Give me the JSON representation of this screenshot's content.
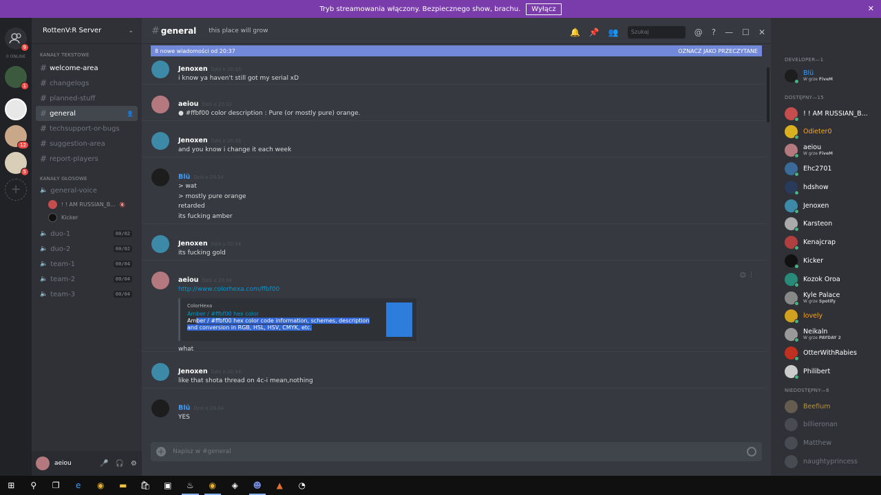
{
  "banner": {
    "text": "Tryb streamowania włączony. Bezpiecznego show, brachu.",
    "button": "Wyłącz"
  },
  "guilds": {
    "online_label": "0 ONLINE",
    "badges": [
      "9",
      "1",
      "",
      "12",
      "5"
    ]
  },
  "server": {
    "name": "RottenV:R Server"
  },
  "text_category": "KANAŁY TEKSTOWE",
  "text_channels": [
    {
      "name": "welcome-area"
    },
    {
      "name": "changelogs"
    },
    {
      "name": "planned-stuff"
    },
    {
      "name": "general"
    },
    {
      "name": "techsupport-or-bugs"
    },
    {
      "name": "suggestion-area"
    },
    {
      "name": "report-players"
    }
  ],
  "voice_category": "KANAŁY GŁOSOWE",
  "voice_channels": [
    {
      "name": "general-voice",
      "count": ""
    },
    {
      "name": "duo-1",
      "count": "00/02"
    },
    {
      "name": "duo-2",
      "count": "00/02"
    },
    {
      "name": "team-1",
      "count": "00/04"
    },
    {
      "name": "team-2",
      "count": "00/04"
    },
    {
      "name": "team-3",
      "count": "00/04"
    }
  ],
  "voice_users": [
    "! ! AM RUSSIAN_B...",
    "Kicker"
  ],
  "current_user": {
    "name": "aeiou"
  },
  "channel": {
    "name": "general",
    "topic": "this place will grow"
  },
  "search": {
    "placeholder": "Szukaj"
  },
  "new_messages": {
    "text": "8 nowe wiadomości od 20:37",
    "mark_read": "OZNACZ JAKO PRZECZYTANE"
  },
  "messages": [
    {
      "author": "Jenoxen",
      "time": "Dziś o 20:33",
      "lines": [
        "i know  ya haven't still got my serial xD"
      ]
    },
    {
      "author": "aeiou",
      "time": "Dziś o 20:33",
      "lines": [
        "● #ffbf00 color description : Pure (or mostly pure) orange."
      ]
    },
    {
      "author": "Jenoxen",
      "time": "Dziś o 20:33",
      "lines": [
        "and you know i change it each week"
      ]
    },
    {
      "author": "Blü",
      "time": "Dziś o 20:34",
      "lines": [
        "> wat",
        "> mostly pure orange",
        "retarded",
        "its fucking amber"
      ]
    },
    {
      "author": "Jenoxen",
      "time": "Dziś o 20:34",
      "lines": [
        "its fucking gold"
      ]
    },
    {
      "author": "aeiou",
      "time": "Dziś o 20:34",
      "link": "http://www.colorhexa.com/ffbf00",
      "after": "what"
    },
    {
      "author": "Jenoxen",
      "time": "Dziś o 20:34",
      "lines": [
        "like that shota thread on 4c-i mean,nothing"
      ]
    },
    {
      "author": "Blü",
      "time": "Dziś o 20:34",
      "lines": [
        "YES"
      ]
    }
  ],
  "embed": {
    "provider": "ColorHexa",
    "title": "Amber / #ffbf00 hex color",
    "desc_a": "Am",
    "desc_b": "ber / #ffbf00 hex color code information, schemes, description and conversion in RGB, HSL, HSV, CMYK, etc."
  },
  "composer": {
    "placeholder": "Napisz w #general"
  },
  "members": {
    "developer_label": "DEVELOPER—1",
    "developer": [
      {
        "name": "Blü",
        "sub_a": "W grze ",
        "sub_b": "FiveM"
      }
    ],
    "online_label": "DOSTĘPNY—15",
    "online": [
      {
        "name": "! ! AM RUSSIAN_B...",
        "sub_a": "",
        "sub_b": ""
      },
      {
        "name": "Odieter0",
        "sub_a": "",
        "sub_b": ""
      },
      {
        "name": "aeiou",
        "sub_a": "W grze ",
        "sub_b": "FiveM"
      },
      {
        "name": "Ehc2701",
        "sub_a": "",
        "sub_b": ""
      },
      {
        "name": "hdshow",
        "sub_a": "",
        "sub_b": ""
      },
      {
        "name": "Jenoxen",
        "sub_a": "",
        "sub_b": ""
      },
      {
        "name": "Karsteon",
        "sub_a": "",
        "sub_b": ""
      },
      {
        "name": "Kenajcrap",
        "sub_a": "",
        "sub_b": ""
      },
      {
        "name": "Kicker",
        "sub_a": "",
        "sub_b": ""
      },
      {
        "name": "Kozok Oroa",
        "sub_a": "",
        "sub_b": ""
      },
      {
        "name": "Kyle Palace",
        "sub_a": "W grze ",
        "sub_b": "Spotify"
      },
      {
        "name": "lovely",
        "sub_a": "",
        "sub_b": ""
      },
      {
        "name": "Neikaln",
        "sub_a": "W grze ",
        "sub_b": "PAYDAY 2"
      },
      {
        "name": "OtterWithRabies",
        "sub_a": "",
        "sub_b": ""
      },
      {
        "name": "Philibert",
        "sub_a": "",
        "sub_b": ""
      }
    ],
    "offline_label": "NIEDOSTĘPNY—6",
    "offline": [
      {
        "name": "Beefium"
      },
      {
        "name": "billieronan"
      },
      {
        "name": "Matthew"
      },
      {
        "name": "naughtyprincess"
      }
    ]
  },
  "colors": {
    "accent": "#7289da",
    "banner": "#7a3bab",
    "online": "#43b581",
    "link": "#0096cf",
    "amber": "#ffbf00"
  }
}
